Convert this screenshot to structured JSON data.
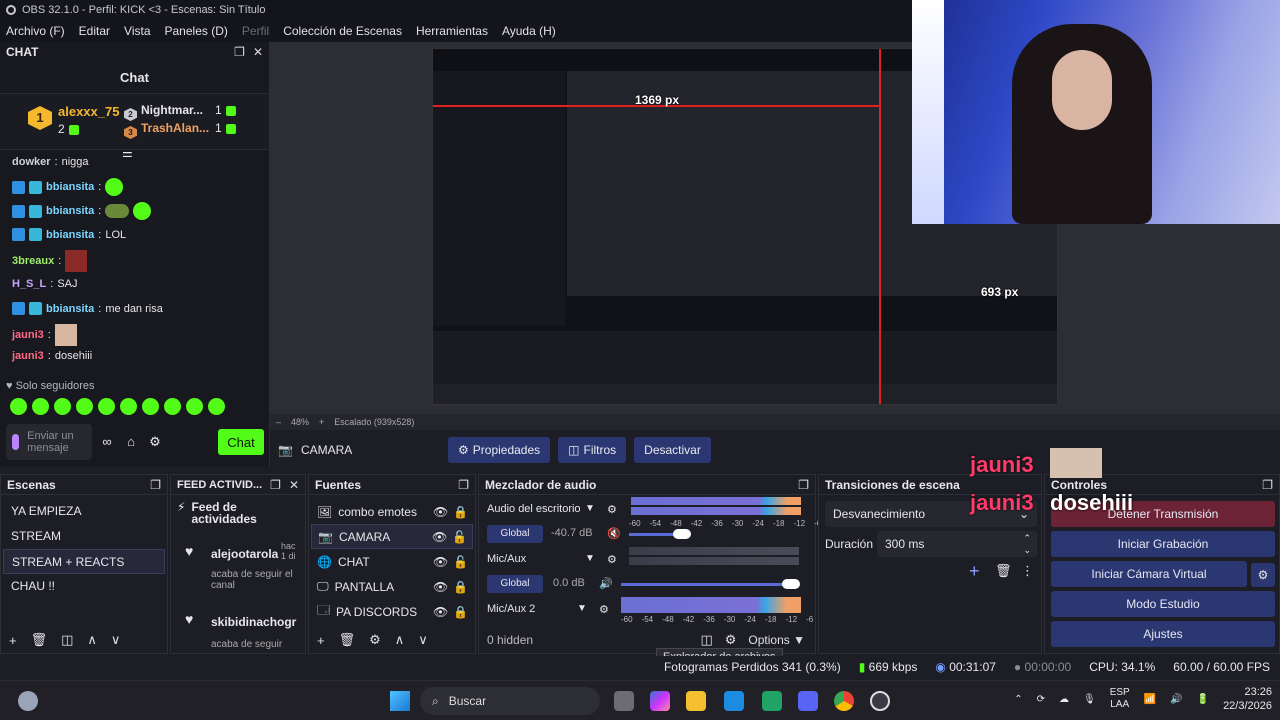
{
  "window": {
    "title": "OBS 32.1.0 - Perfil: KICK <3 - Escenas: Sin Título"
  },
  "menu": [
    "Archivo (F)",
    "Editar",
    "Vista",
    "Paneles (D)",
    "Perfil",
    "Colección de Escenas",
    "Herramientas",
    "Ayuda (H)"
  ],
  "chat": {
    "dock_title": "CHAT",
    "title": "Chat",
    "leaderboard": {
      "first": {
        "rank": "1",
        "name": "alexxx_75",
        "count": "2"
      },
      "second": {
        "rank": "2",
        "name": "Nightmar...",
        "count": "1"
      },
      "third": {
        "rank": "3",
        "name": "TrashAlan...",
        "count": "1"
      }
    },
    "messages": [
      {
        "user": "dowker",
        "text": "nigga"
      },
      {
        "user": "bbiansita",
        "text": ""
      },
      {
        "user": "bbiansita",
        "text": ""
      },
      {
        "user": "bbiansita",
        "text": "LOL"
      },
      {
        "user": "3breaux",
        "text": ""
      },
      {
        "user": "H_S_L",
        "text": "SAJ"
      },
      {
        "user": "bbiansita",
        "text": "me dan risa"
      },
      {
        "user": "jauni3",
        "text": ""
      },
      {
        "user": "jauni3",
        "text": "dosehiii"
      }
    ],
    "followers_only": "Solo seguidores",
    "input_placeholder": "Enviar un mensaje",
    "send_label": "Chat"
  },
  "preview": {
    "measure_h": "1369 px",
    "measure_v": "693 px",
    "zoom": "48%",
    "scaled": "Escalado (939x528)"
  },
  "toolbar": {
    "source_name": "CAMARA",
    "properties": "Propiedades",
    "filters": "Filtros",
    "deactivate": "Desactivar"
  },
  "scenes": {
    "title": "Escenas",
    "items": [
      "YA EMPIEZA",
      "STREAM",
      "STREAM + REACTS",
      "CHAU !!"
    ],
    "selected": 2
  },
  "feed": {
    "title": "FEED ACTIVID...",
    "header": "Feed de actividades",
    "events": [
      {
        "user": "alejootarola",
        "time": "hac 1 di",
        "text": "acaba de seguir el canal"
      },
      {
        "user": "skibidinachogr",
        "time": "",
        "text": "acaba de seguir"
      }
    ]
  },
  "sources": {
    "title": "Fuentes",
    "items": [
      {
        "name": "combo emotes",
        "icon": "image-icon"
      },
      {
        "name": "CAMARA",
        "icon": "camera-icon"
      },
      {
        "name": "CHAT",
        "icon": "globe-icon"
      },
      {
        "name": "PANTALLA",
        "icon": "monitor-icon"
      },
      {
        "name": "PA DISCORDS",
        "icon": "window-icon"
      }
    ],
    "selected": 1
  },
  "mixer": {
    "title": "Mezclador de audio",
    "channels": [
      {
        "name": "Audio del escritorio",
        "db": "-40.7 dB",
        "tag": "Global",
        "muted": true,
        "level": 0.22,
        "volume": 0.31
      },
      {
        "name": "Mic/Aux",
        "db": "0.0 dB",
        "tag": "Global",
        "muted": false,
        "level": 0.0,
        "volume": 1.0
      },
      {
        "name": "Mic/Aux 2",
        "db": "",
        "tag": "",
        "muted": false,
        "level": 0.68,
        "volume": 1.0
      }
    ],
    "scale": [
      "-60",
      "-54",
      "-48",
      "-42",
      "-36",
      "-30",
      "-24",
      "-18",
      "-12",
      "-6",
      "0"
    ],
    "hidden": "0 hidden",
    "options": "Options"
  },
  "transitions": {
    "title": "Transiciones de escena",
    "selected": "Desvanecimiento",
    "duration_label": "Duración",
    "duration": "300 ms"
  },
  "controls": {
    "title": "Controles",
    "stop_stream": "Detener Transmisión",
    "start_recording": "Iniciar Grabación",
    "start_virtualcam": "Iniciar Cámara Virtual",
    "studio_mode": "Modo Estudio",
    "settings": "Ajustes"
  },
  "overlay": {
    "user": "jauni3",
    "message": "dosehiii"
  },
  "tooltip": "Explorador de archivos",
  "status": {
    "dropped": "Fotogramas Perdidos 341 (0.3%)",
    "bitrate": "669 kbps",
    "stream_time": "00:31:07",
    "rec_time": "00:00:00",
    "cpu": "CPU: 34.1%",
    "fps": "60.00 / 60.00 FPS"
  },
  "taskbar": {
    "search": "Buscar",
    "lang": "ESP",
    "lang2": "LAA",
    "time": "23:26",
    "date": "22/3/2026"
  },
  "colors": {
    "kick_green": "#53fc18",
    "obs_blue": "#2b3770",
    "stop_red": "#6d2336"
  }
}
